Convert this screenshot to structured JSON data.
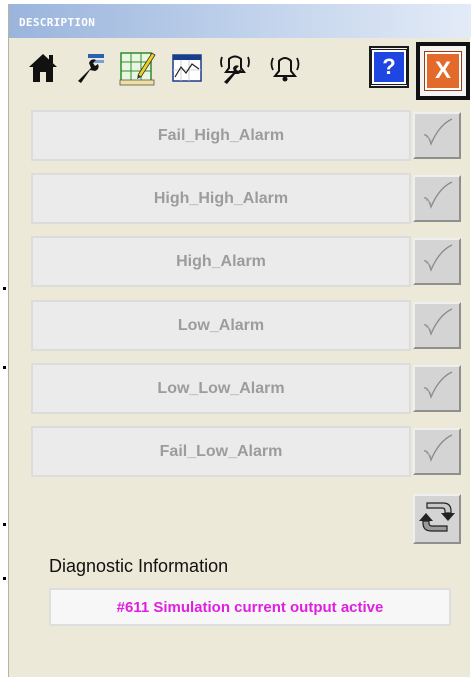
{
  "window": {
    "title": "DESCRIPTION"
  },
  "toolbar": {
    "icons": [
      "home-icon",
      "wrench-icon",
      "pencil-chart-icon",
      "trend-chart-icon",
      "alarm-wrench-icon",
      "bell-icon"
    ],
    "help_label": "?",
    "close_label": "X"
  },
  "alarms": [
    {
      "label": "Fail_High_Alarm",
      "checked": false
    },
    {
      "label": "High_High_Alarm",
      "checked": false
    },
    {
      "label": "High_Alarm",
      "checked": false
    },
    {
      "label": "Low_Alarm",
      "checked": false
    },
    {
      "label": "Low_Low_Alarm",
      "checked": false
    },
    {
      "label": "Fail_Low_Alarm",
      "checked": false
    }
  ],
  "diagnostic": {
    "label": "Diagnostic Information",
    "message": "#611 Simulation current output active"
  },
  "colors": {
    "message": "#e020e0",
    "alarm_text": "#9c9c9c",
    "close_accent": "#e46a2c",
    "help_accent": "#1f46e0"
  }
}
